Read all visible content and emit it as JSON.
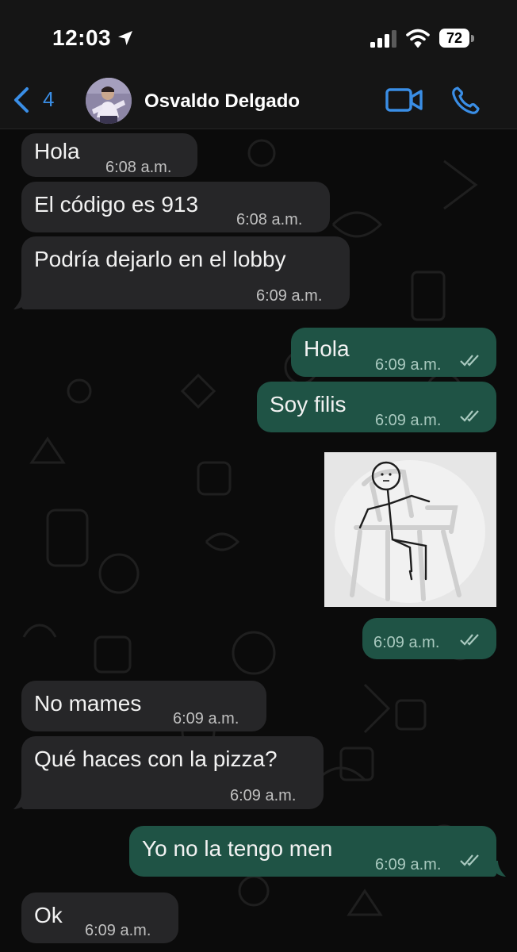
{
  "status_bar": {
    "time": "12:03",
    "battery": "72"
  },
  "header": {
    "back_count": "4",
    "contact_name": "Osvaldo Delgado"
  },
  "messages": [
    {
      "dir": "in",
      "text": "Hola",
      "time": "6:08 a.m."
    },
    {
      "dir": "in",
      "text": "El código es 913",
      "time": "6:08 a.m."
    },
    {
      "dir": "in",
      "text": "Podría dejarlo en el lobby",
      "time": "6:09 a.m."
    },
    {
      "dir": "out",
      "text": "Hola",
      "time": "6:09 a.m."
    },
    {
      "dir": "out",
      "text": "Soy filis",
      "time": "6:09 a.m."
    },
    {
      "dir": "out",
      "type": "image",
      "image_desc": "stick figure sitting on plastic chair",
      "time": "6:09 a.m."
    },
    {
      "dir": "in",
      "text": "No mames",
      "time": "6:09 a.m."
    },
    {
      "dir": "in",
      "text": "Qué haces con la pizza?",
      "time": "6:09 a.m."
    },
    {
      "dir": "out",
      "text": "Yo no la tengo men",
      "time": "6:09 a.m."
    },
    {
      "dir": "in",
      "text": "Ok",
      "time": "6:09 a.m."
    }
  ],
  "colors": {
    "accent": "#3a8ee6",
    "incoming_bubble": "#262628",
    "outgoing_bubble": "#1f5345",
    "background": "#0b0b0b"
  },
  "icons": [
    "location-arrow-icon",
    "signal-icon",
    "wifi-icon",
    "battery-icon",
    "chevron-left-icon",
    "video-camera-icon",
    "phone-icon",
    "double-check-icon"
  ]
}
